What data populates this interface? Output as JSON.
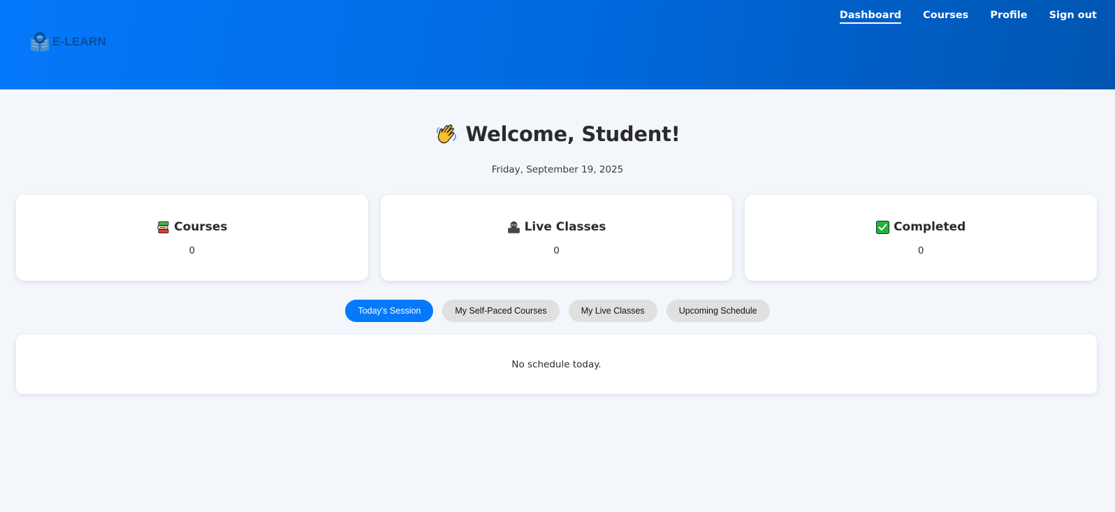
{
  "header": {
    "logo_text": "E-LEARN",
    "logo_icon": "book-graduation-icon",
    "nav": [
      {
        "label": "Dashboard",
        "active": true
      },
      {
        "label": "Courses",
        "active": false
      },
      {
        "label": "Profile",
        "active": false
      },
      {
        "label": "Sign out",
        "active": false
      }
    ],
    "gradient_colors": [
      "#0479fb",
      "#0055b0"
    ]
  },
  "welcome": {
    "icon": "waving-hand-icon",
    "title": "Welcome, Student!",
    "date": "Friday, September 19, 2025"
  },
  "stats": [
    {
      "icon": "books-icon",
      "label": "Courses",
      "value": "0"
    },
    {
      "icon": "teacher-icon",
      "label": "Live Classes",
      "value": "0"
    },
    {
      "icon": "check-box-icon",
      "label": "Completed",
      "value": "0"
    }
  ],
  "tabs": [
    {
      "label": "Today's Session",
      "active": true
    },
    {
      "label": "My Self-Paced Courses",
      "active": false
    },
    {
      "label": "My Live Classes",
      "active": false
    },
    {
      "label": "Upcoming Schedule",
      "active": false
    }
  ],
  "schedule": {
    "empty_message": "No schedule today."
  },
  "colors": {
    "accent": "#0479fb",
    "page_bg": "#f3f7fb",
    "tab_inactive": "#e0e0e0",
    "check_green": "#22b33a"
  }
}
